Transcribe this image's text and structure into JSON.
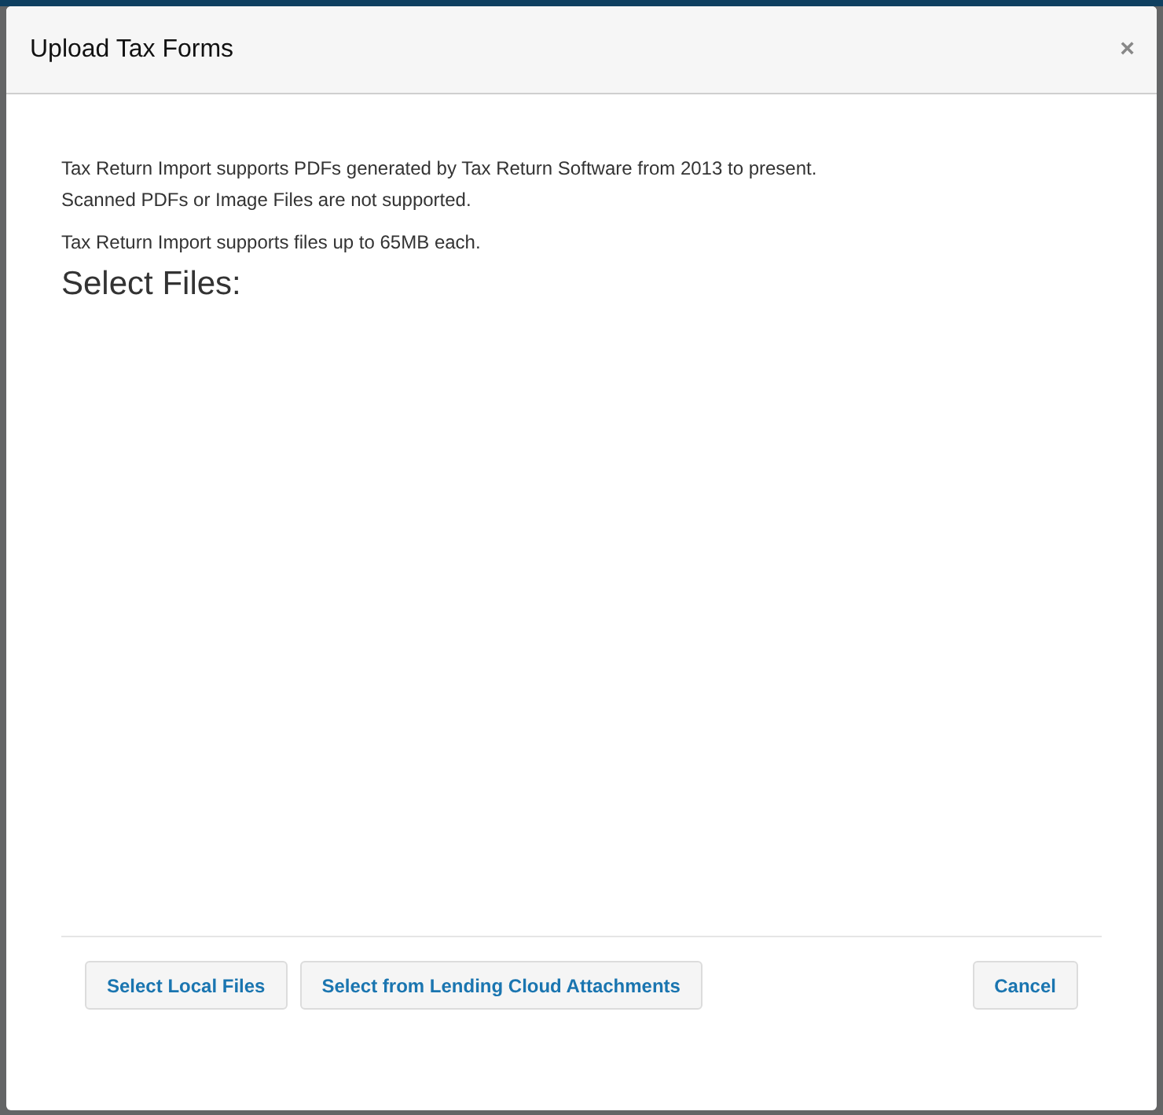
{
  "dialog": {
    "title": "Upload Tax Forms",
    "close": "×",
    "notes": [
      "Tax Return Import supports PDFs generated by Tax Return Software from 2013 to present.",
      "Scanned PDFs or Image Files are not supported.",
      "Tax Return Import supports files up to 65MB each."
    ],
    "heading": "Select Files:",
    "buttons": [
      {
        "label": "Select Local Files",
        "kind": "left"
      },
      {
        "label": "Select from Lending Cloud Attachments",
        "kind": "left"
      },
      {
        "label": "Cancel",
        "kind": "right"
      }
    ]
  }
}
